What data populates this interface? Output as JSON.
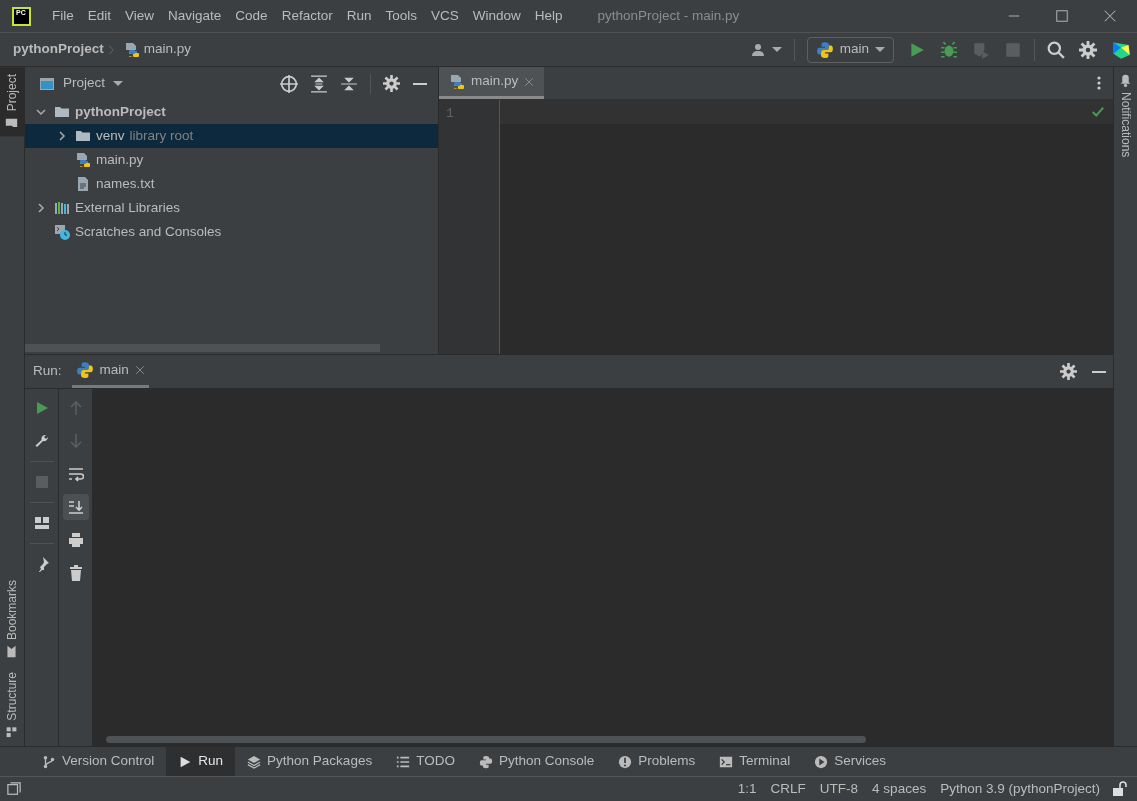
{
  "window": {
    "title": "pythonProject - main.py",
    "logo": "PC"
  },
  "menu": [
    "File",
    "Edit",
    "View",
    "Navigate",
    "Code",
    "Refactor",
    "Run",
    "Tools",
    "VCS",
    "Window",
    "Help"
  ],
  "breadcrumb": [
    {
      "label": "pythonProject"
    },
    {
      "label": "main.py",
      "kind": "python"
    }
  ],
  "run_config": {
    "label": "main"
  },
  "toolbar": [
    {
      "kind": "run",
      "disabled": false
    },
    {
      "kind": "debug",
      "disabled": false
    },
    {
      "kind": "coverage",
      "disabled": true
    },
    {
      "kind": "stop",
      "disabled": true
    }
  ],
  "left_strip": [
    {
      "label": "Project",
      "selected": true
    },
    {
      "label": "Bookmarks",
      "selected": false
    },
    {
      "label": "Structure",
      "selected": false
    }
  ],
  "right_strip": [
    {
      "label": "Notifications"
    }
  ],
  "project_panel": {
    "title": "Project",
    "tree": [
      {
        "label": "pythonProject",
        "kind": "folder",
        "expanded": true,
        "selected": false,
        "children": [
          {
            "label": "venv",
            "hint": "library root",
            "kind": "folder",
            "expanded": false,
            "selected": true
          },
          {
            "label": "main.py",
            "kind": "python",
            "selected": false
          },
          {
            "label": "names.txt",
            "kind": "text",
            "selected": false
          }
        ]
      },
      {
        "label": "External Libraries",
        "kind": "library",
        "expanded": false,
        "selected": false
      },
      {
        "label": "Scratches and Consoles",
        "kind": "scratch",
        "selected": false
      }
    ]
  },
  "editor": {
    "tabs": [
      {
        "label": "main.py",
        "selected": true
      }
    ],
    "line_numbers": [
      "1"
    ]
  },
  "run_panel": {
    "label": "Run:",
    "tabs": [
      {
        "label": "main",
        "selected": true
      }
    ],
    "toolbar_left": [
      {
        "kind": "run",
        "disabled": false
      },
      {
        "kind": "wrench",
        "disabled": false
      },
      {
        "kind": "stop",
        "disabled": true
      },
      {
        "kind": "layout",
        "disabled": false
      },
      {
        "kind": "pin",
        "disabled": false
      }
    ],
    "toolbar_right": [
      {
        "kind": "up",
        "on": false,
        "disabled": true
      },
      {
        "kind": "down",
        "on": false,
        "disabled": true
      },
      {
        "kind": "wrap",
        "on": false,
        "disabled": false
      },
      {
        "kind": "scroll",
        "on": true,
        "disabled": false
      },
      {
        "kind": "print",
        "on": false,
        "disabled": false
      },
      {
        "kind": "trash",
        "on": false,
        "disabled": false
      }
    ]
  },
  "tool_tabs": [
    {
      "label": "Version Control",
      "kind": "vcs",
      "selected": false
    },
    {
      "label": "Run",
      "kind": "run",
      "selected": true
    },
    {
      "label": "Python Packages",
      "kind": "packages",
      "selected": false
    },
    {
      "label": "TODO",
      "kind": "todo",
      "selected": false
    },
    {
      "label": "Python Console",
      "kind": "console",
      "selected": false
    },
    {
      "label": "Problems",
      "kind": "problems",
      "selected": false
    },
    {
      "label": "Terminal",
      "kind": "terminal",
      "selected": false
    },
    {
      "label": "Services",
      "kind": "services",
      "selected": false
    }
  ],
  "status_bar": [
    "1:1",
    "CRLF",
    "UTF-8",
    "4 spaces",
    "Python 3.9 (pythonProject)"
  ]
}
